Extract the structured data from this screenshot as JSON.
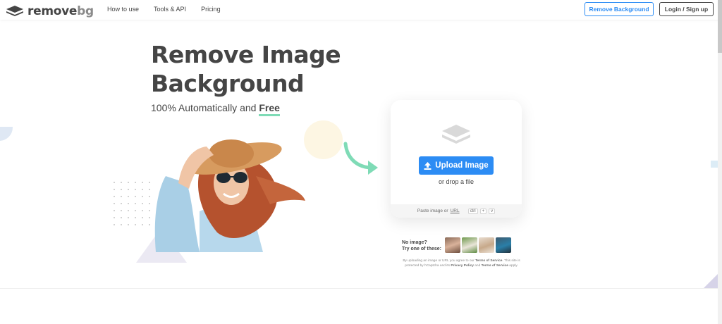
{
  "header": {
    "logo_text_main": "remove",
    "logo_text_suffix": "bg",
    "nav": [
      "How to use",
      "Tools & API",
      "Pricing"
    ],
    "remove_background_label": "Remove Background",
    "login_label": "Login / Sign up"
  },
  "hero": {
    "title_line1": "Remove Image",
    "title_line2": "Background",
    "subtitle_prefix": "100% Automatically and ",
    "subtitle_free": "Free"
  },
  "upload": {
    "button_label": "Upload Image",
    "drop_text": "or drop a file",
    "paste_prefix": "Paste image or ",
    "paste_url": "URL",
    "key_ctrl": "ctrl",
    "key_plus": "+",
    "key_v": "v"
  },
  "samples": {
    "no_image_line1": "No image?",
    "no_image_line2": "Try one of these:",
    "items": [
      "sample-person",
      "sample-animal",
      "sample-product",
      "sample-car"
    ]
  },
  "terms": {
    "prefix": "By uploading an image or URL you agree to our ",
    "tos": "Terms of Service",
    "mid": ". This site is protected by hCaptcha and its ",
    "privacy": "Privacy Policy",
    "and": " and ",
    "tos2": "Terms of Service",
    "suffix": " apply."
  },
  "colors": {
    "accent": "#2c8cf4",
    "text": "#454545",
    "underline": "#7fdbb6"
  }
}
